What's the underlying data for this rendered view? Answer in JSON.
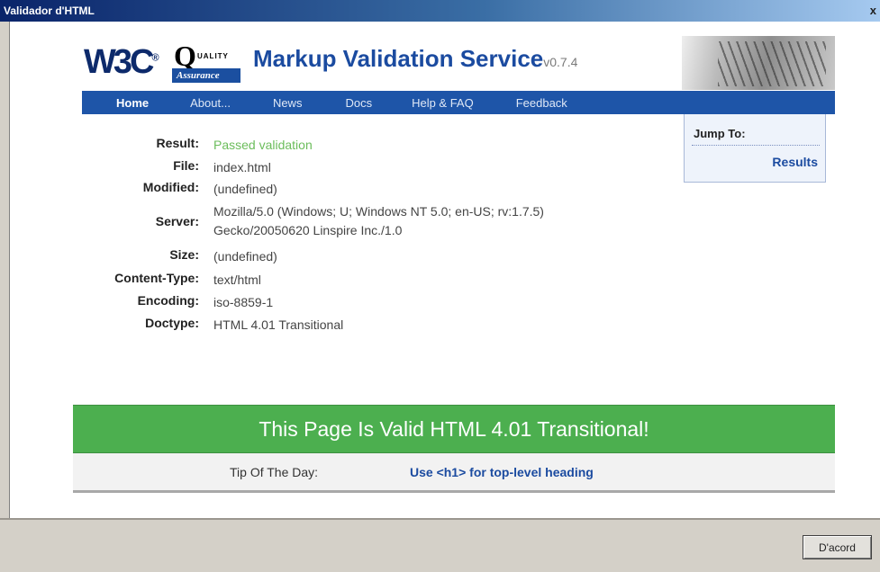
{
  "window": {
    "title": "Validador d'HTML",
    "close_glyph": "x"
  },
  "banner": {
    "w3c_logo": "W3C",
    "w3c_reg": "®",
    "qa_q": "Q",
    "qa_quality": "UALITY",
    "qa_assurance": "Assurance",
    "service_title": "Markup Validation Service",
    "version": "v0.7.4"
  },
  "nav": {
    "items": [
      {
        "label": "Home",
        "active": true
      },
      {
        "label": "About...",
        "active": false
      },
      {
        "label": "News",
        "active": false
      },
      {
        "label": "Docs",
        "active": false
      },
      {
        "label": "Help & FAQ",
        "active": false
      },
      {
        "label": "Feedback",
        "active": false
      }
    ]
  },
  "info": {
    "rows": [
      {
        "label": "Result:",
        "value": "Passed validation"
      },
      {
        "label": "File:",
        "value": "index.html"
      },
      {
        "label": "Modified:",
        "value": "(undefined)"
      },
      {
        "label": "Server:",
        "value": "Mozilla/5.0 (Windows; U; Windows NT 5.0; en-US; rv:1.7.5)",
        "value2": "Gecko/20050620 Linspire Inc./1.0"
      },
      {
        "label": "Size:",
        "value": "(undefined)"
      },
      {
        "label": "Content-Type:",
        "value": "text/html"
      },
      {
        "label": "Encoding:",
        "value": "iso-8859-1"
      },
      {
        "label": "Doctype:",
        "value": "HTML 4.01 Transitional"
      }
    ]
  },
  "jump_to": {
    "title": "Jump To:",
    "link": "Results"
  },
  "valid_message": "This Page Is Valid HTML 4.01 Transitional!",
  "tip": {
    "label": "Tip Of The Day:",
    "link": "Use <h1> for top-level heading"
  },
  "footer": {
    "ok_label": "D'acord"
  },
  "colors": {
    "nav_bg": "#1e55a8",
    "valid_green": "#4caf4f",
    "pass_text": "#6bbd5b",
    "link_blue": "#1b4ba0"
  }
}
